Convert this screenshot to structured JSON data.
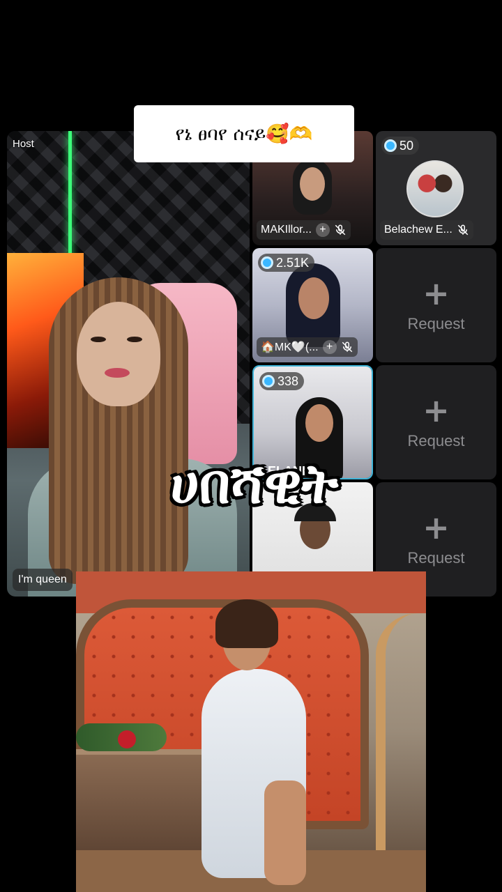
{
  "caption": {
    "text": "የኔ ፀባየ ሰናይ🥰🫶"
  },
  "overlay_title": {
    "text": "ሀበሻዊት"
  },
  "host": {
    "label": "Host",
    "name": "I'm queen"
  },
  "guests": [
    {
      "name": "MAKIllor...",
      "badge": ""
    },
    {
      "name": "Belachew E...",
      "badge": "50"
    },
    {
      "name": "🏠MK🤍(...",
      "badge": "2.51K"
    },
    {
      "name": "",
      "badge": "338",
      "partial_name": "ELANI"
    },
    {
      "name": "",
      "badge": ""
    }
  ],
  "request_slots": [
    {
      "label": "Request",
      "plus": "+"
    },
    {
      "label": "Request",
      "plus": "+"
    },
    {
      "label": "Request",
      "plus": "+"
    }
  ],
  "mini_plus": "+",
  "colors": {
    "badge_dot": "#3ab7ff",
    "request_text": "#8d8d90",
    "tile_bg": "#1f1f21"
  }
}
